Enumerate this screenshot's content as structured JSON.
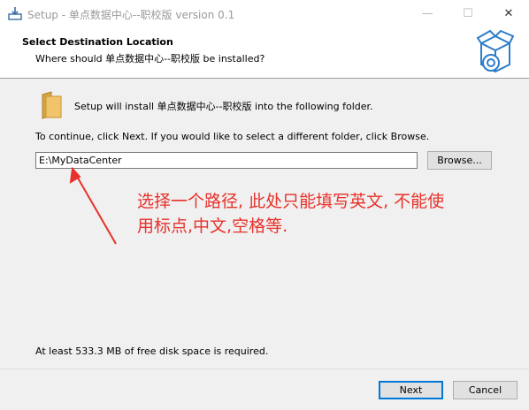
{
  "window": {
    "title": "Setup - 单点数据中心--职校版 version 0.1",
    "minimize_glyph": "—",
    "maximize_glyph": "☐",
    "close_glyph": "✕"
  },
  "header": {
    "title": "Select Destination Location",
    "subtitle": "Where should 单点数据中心--职校版 be installed?",
    "icon": "software-box-icon"
  },
  "body": {
    "setup_line": "Setup will install 单点数据中心--职校版 into the following folder.",
    "continue_line": "To continue, click Next. If you would like to select a different folder, click Browse.",
    "path_value": "E:\\MyDataCenter",
    "browse_label": "Browse...",
    "disk_space": "At least 533.3 MB of free disk space is required.",
    "folder_icon": "folder-icon"
  },
  "annotation": {
    "line1": "选择一个路径, 此处只能填写英文, 不能使",
    "line2": "用标点,中文,空格等.",
    "color": "#e8312a"
  },
  "footer": {
    "next_label": "Next",
    "cancel_label": "Cancel"
  }
}
